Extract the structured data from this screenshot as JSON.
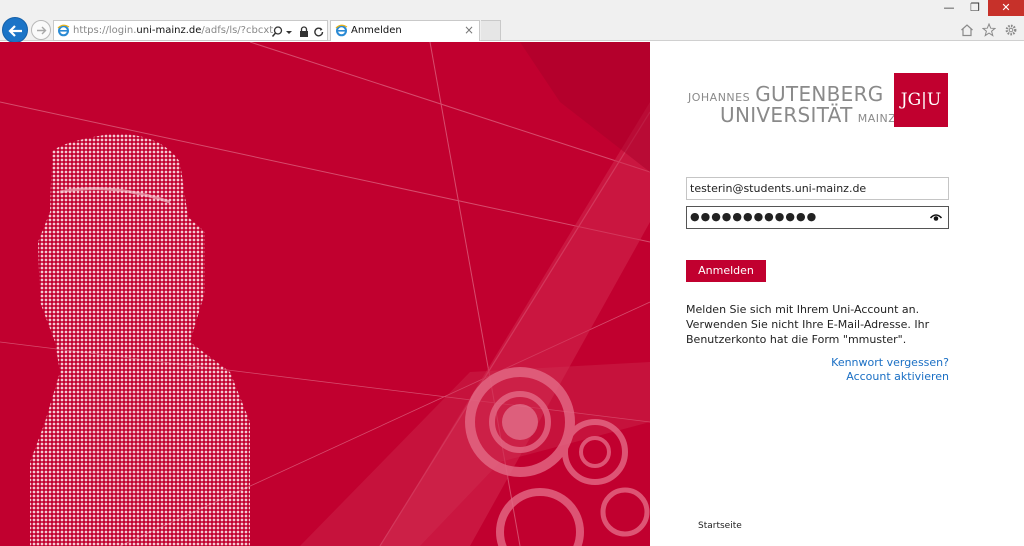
{
  "browser": {
    "url_prefix": "https://login.",
    "url_domain": "uni-mainz.de",
    "url_rest": "/adfs/ls/?cbcxt=&popup",
    "tab_title": "Anmelden",
    "tab_close": "×"
  },
  "window": {
    "minimize": "—",
    "restore": "❐",
    "close": "✕"
  },
  "logo": {
    "johannes": "JOHANNES",
    "gutenberg": "GUTENBERG",
    "universitat": "UNIVERSITÄT",
    "mainz": "MAINZ",
    "mark": "JG|U"
  },
  "form": {
    "username_value": "testerin@students.uni-mainz.de",
    "password_value": "●●●●●●●●●●●●",
    "submit_label": "Anmelden"
  },
  "help_text": "Melden Sie sich mit Ihrem Uni-Account an. Verwenden Sie nicht Ihre E-Mail-Adresse. Ihr Benutzerkonto hat die Form \"mmuster\".",
  "links": {
    "forgot_password": "Kennwort vergessen?",
    "activate_account": "Account aktivieren"
  },
  "footer": {
    "startseite": "Startseite"
  },
  "colors": {
    "brand_red": "#c1002f",
    "link_blue": "#1a6fc4"
  }
}
